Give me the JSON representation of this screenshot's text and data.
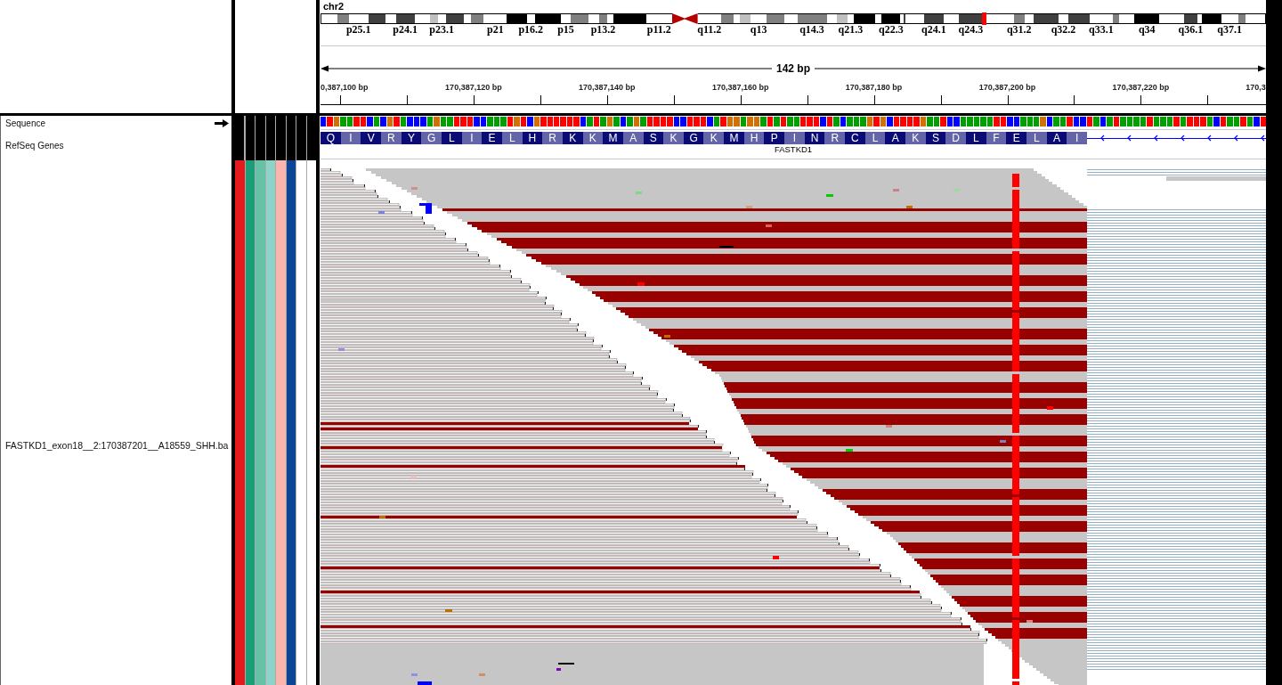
{
  "ideogram": {
    "chromosome": "chr2",
    "bands": [
      {
        "kind": "band",
        "color": "#ffffff"
      },
      {
        "kind": "band",
        "color": "#808080"
      },
      {
        "kind": "band",
        "color": "#ffffff",
        "label": "p25.1"
      },
      {
        "kind": "band",
        "color": "#404040"
      },
      {
        "kind": "band",
        "color": "#ffffff"
      },
      {
        "kind": "band",
        "color": "#404040",
        "label": "p24.1"
      },
      {
        "kind": "band",
        "color": "#ffffff"
      },
      {
        "kind": "band",
        "color": "#c0c0c0"
      },
      {
        "kind": "band",
        "color": "#ffffff",
        "label": "p23.1"
      },
      {
        "kind": "band",
        "color": "#404040"
      },
      {
        "kind": "band",
        "color": "#ffffff"
      },
      {
        "kind": "band",
        "color": "#808080"
      },
      {
        "kind": "band",
        "color": "#ffffff",
        "label": "p21"
      },
      {
        "kind": "band",
        "color": "#000000"
      },
      {
        "kind": "band",
        "color": "#ffffff",
        "label": "p16.2"
      },
      {
        "kind": "band",
        "color": "#000000"
      },
      {
        "kind": "band",
        "color": "#ffffff",
        "label": "p15"
      },
      {
        "kind": "band",
        "color": "#808080"
      },
      {
        "kind": "band",
        "color": "#ffffff"
      },
      {
        "kind": "band",
        "color": "#808080",
        "label": "p13.2"
      },
      {
        "kind": "band",
        "color": "#ffffff"
      },
      {
        "kind": "band",
        "color": "#000000"
      },
      {
        "kind": "band",
        "color": "#ffffff",
        "label": "p11.2"
      },
      {
        "kind": "centromere",
        "color": "#b40000"
      },
      {
        "kind": "centromere",
        "color": "#b40000"
      },
      {
        "kind": "band",
        "color": "#ffffff",
        "label": "q11.2"
      },
      {
        "kind": "band",
        "color": "#808080"
      },
      {
        "kind": "band",
        "color": "#ffffff"
      },
      {
        "kind": "band",
        "color": "#c0c0c0"
      },
      {
        "kind": "band",
        "color": "#ffffff",
        "label": "q13"
      },
      {
        "kind": "band",
        "color": "#808080"
      },
      {
        "kind": "band",
        "color": "#ffffff"
      },
      {
        "kind": "band",
        "color": "#808080",
        "label": "q14.3"
      },
      {
        "kind": "band",
        "color": "#ffffff"
      },
      {
        "kind": "band",
        "color": "#c0c0c0"
      },
      {
        "kind": "band",
        "color": "#ffffff",
        "label": "q21.3"
      },
      {
        "kind": "band",
        "color": "#000000"
      },
      {
        "kind": "band",
        "color": "#ffffff"
      },
      {
        "kind": "band",
        "color": "#000000",
        "label": "q22.3"
      },
      {
        "kind": "band",
        "color": "#ffffff"
      },
      {
        "kind": "band",
        "color": "#404040"
      },
      {
        "kind": "band",
        "color": "#ffffff"
      },
      {
        "kind": "band",
        "color": "#404040",
        "label": "q24.1"
      },
      {
        "kind": "band",
        "color": "#ffffff"
      },
      {
        "kind": "band",
        "color": "#404040",
        "label": "q24.3"
      },
      {
        "kind": "band",
        "color": "#ffffff"
      },
      {
        "kind": "band",
        "color": "#808080",
        "label": "q31.2"
      },
      {
        "kind": "band",
        "color": "#ffffff"
      },
      {
        "kind": "band",
        "color": "#404040"
      },
      {
        "kind": "band",
        "color": "#ffffff",
        "label": "q32.2"
      },
      {
        "kind": "band",
        "color": "#404040"
      },
      {
        "kind": "band",
        "color": "#ffffff",
        "label": "q33.1"
      },
      {
        "kind": "band",
        "color": "#808080"
      },
      {
        "kind": "band",
        "color": "#ffffff"
      },
      {
        "kind": "band",
        "color": "#000000",
        "label": "q34"
      },
      {
        "kind": "band",
        "color": "#ffffff"
      },
      {
        "kind": "band",
        "color": "#404040",
        "label": "q36.1"
      },
      {
        "kind": "band",
        "color": "#ffffff"
      },
      {
        "kind": "band",
        "color": "#000000"
      },
      {
        "kind": "band",
        "color": "#ffffff",
        "label": "q37.1"
      },
      {
        "kind": "band",
        "color": "#808080"
      },
      {
        "kind": "band",
        "color": "#ffffff"
      }
    ]
  },
  "ruler": {
    "span": "142 bp",
    "tick_labels": [
      "0,387,100 bp",
      "170,387,120 bp",
      "170,387,140 bp",
      "170,387,160 bp",
      "170,387,180 bp",
      "170,387,200 bp",
      "170,387,220 bp",
      "170,3"
    ]
  },
  "tracks": [
    {
      "kind": "sequence",
      "name": "Sequence",
      "reverse": false,
      "bases": [
        {
          "color": "#0000ff"
        },
        {
          "color": "#ff0000"
        },
        {
          "color": "#d17105"
        },
        {
          "color": "#00a000"
        },
        {
          "color": "#00a000"
        },
        {
          "color": "#ff0000"
        },
        {
          "color": "#ff0000"
        },
        {
          "color": "#0000ff"
        },
        {
          "color": "#00a000"
        },
        {
          "color": "#0000ff"
        },
        {
          "color": "#d17105"
        },
        {
          "color": "#ff0000"
        },
        {
          "color": "#00a000"
        },
        {
          "color": "#0000ff"
        },
        {
          "color": "#0000ff"
        },
        {
          "color": "#0000ff"
        },
        {
          "color": "#00a000"
        },
        {
          "color": "#d17105"
        },
        {
          "color": "#00a000"
        },
        {
          "color": "#00a000"
        },
        {
          "color": "#ff0000"
        },
        {
          "color": "#ff0000"
        },
        {
          "color": "#ff0000"
        },
        {
          "color": "#0000ff"
        },
        {
          "color": "#0000ff"
        },
        {
          "color": "#00a000"
        },
        {
          "color": "#00a000"
        },
        {
          "color": "#00a000"
        },
        {
          "color": "#ff0000"
        },
        {
          "color": "#d17105"
        },
        {
          "color": "#ff0000"
        },
        {
          "color": "#0000ff"
        },
        {
          "color": "#d17105"
        },
        {
          "color": "#ff0000"
        },
        {
          "color": "#ff0000"
        },
        {
          "color": "#ff0000"
        },
        {
          "color": "#ff0000"
        },
        {
          "color": "#ff0000"
        },
        {
          "color": "#ff0000"
        },
        {
          "color": "#0000ff"
        },
        {
          "color": "#00a000"
        },
        {
          "color": "#ff0000"
        },
        {
          "color": "#00a000"
        },
        {
          "color": "#d17105"
        },
        {
          "color": "#00a000"
        },
        {
          "color": "#0000ff"
        },
        {
          "color": "#00a000"
        },
        {
          "color": "#d17105"
        },
        {
          "color": "#00a000"
        },
        {
          "color": "#ff0000"
        },
        {
          "color": "#ff0000"
        },
        {
          "color": "#ff0000"
        },
        {
          "color": "#ff0000"
        },
        {
          "color": "#0000ff"
        },
        {
          "color": "#0000ff"
        },
        {
          "color": "#ff0000"
        },
        {
          "color": "#ff0000"
        },
        {
          "color": "#ff0000"
        },
        {
          "color": "#0000ff"
        },
        {
          "color": "#00a000"
        },
        {
          "color": "#ff0000"
        },
        {
          "color": "#d17105"
        },
        {
          "color": "#d17105"
        },
        {
          "color": "#00a000"
        },
        {
          "color": "#d17105"
        },
        {
          "color": "#d17105"
        },
        {
          "color": "#00a000"
        },
        {
          "color": "#ff0000"
        },
        {
          "color": "#00a000"
        },
        {
          "color": "#ff0000"
        },
        {
          "color": "#00a000"
        },
        {
          "color": "#00a000"
        },
        {
          "color": "#ff0000"
        },
        {
          "color": "#ff0000"
        },
        {
          "color": "#ff0000"
        },
        {
          "color": "#0000ff"
        },
        {
          "color": "#ff0000"
        },
        {
          "color": "#00a000"
        },
        {
          "color": "#0000ff"
        },
        {
          "color": "#00a000"
        },
        {
          "color": "#00a000"
        },
        {
          "color": "#00a000"
        },
        {
          "color": "#d17105"
        },
        {
          "color": "#ff0000"
        },
        {
          "color": "#d17105"
        },
        {
          "color": "#0000ff"
        },
        {
          "color": "#ff0000"
        },
        {
          "color": "#ff0000"
        },
        {
          "color": "#ff0000"
        },
        {
          "color": "#ff0000"
        },
        {
          "color": "#d17105"
        },
        {
          "color": "#00a000"
        },
        {
          "color": "#00a000"
        },
        {
          "color": "#ff0000"
        },
        {
          "color": "#0000ff"
        },
        {
          "color": "#0000ff"
        },
        {
          "color": "#00a000"
        },
        {
          "color": "#00a000"
        },
        {
          "color": "#00a000"
        },
        {
          "color": "#00a000"
        },
        {
          "color": "#00a000"
        },
        {
          "color": "#ff0000"
        },
        {
          "color": "#ff0000"
        },
        {
          "color": "#0000ff"
        },
        {
          "color": "#0000ff"
        },
        {
          "color": "#00a000"
        },
        {
          "color": "#00a000"
        },
        {
          "color": "#00a000"
        },
        {
          "color": "#d17105"
        },
        {
          "color": "#0000ff"
        },
        {
          "color": "#00a000"
        },
        {
          "color": "#00a000"
        },
        {
          "color": "#ff0000"
        },
        {
          "color": "#0000ff"
        },
        {
          "color": "#0000ff"
        },
        {
          "color": "#ff0000"
        },
        {
          "color": "#00a000"
        },
        {
          "color": "#0000ff"
        },
        {
          "color": "#00a000"
        },
        {
          "color": "#ff0000"
        },
        {
          "color": "#00a000"
        },
        {
          "color": "#00a000"
        },
        {
          "color": "#00a000"
        },
        {
          "color": "#00a000"
        },
        {
          "color": "#ff0000"
        },
        {
          "color": "#00a000"
        },
        {
          "color": "#00a000"
        },
        {
          "color": "#00a000"
        },
        {
          "color": "#ff0000"
        },
        {
          "color": "#00a000"
        },
        {
          "color": "#ff0000"
        },
        {
          "color": "#ff0000"
        },
        {
          "color": "#ff0000"
        },
        {
          "color": "#00a000"
        },
        {
          "color": "#0000ff"
        },
        {
          "color": "#ff0000"
        },
        {
          "color": "#00a000"
        },
        {
          "color": "#00a000"
        },
        {
          "color": "#ff0000"
        },
        {
          "color": "#00a000"
        },
        {
          "color": "#0000ff"
        },
        {
          "color": "#ff0000"
        }
      ]
    },
    {
      "kind": "gene",
      "name": "RefSeq Genes",
      "gene": "FASTKD1",
      "reverse": true,
      "amino_acids": [
        "Q",
        "I",
        "V",
        "R",
        "Y",
        "G",
        "L",
        "I",
        "E",
        "L",
        "H",
        "R",
        "K",
        "K",
        "M",
        "A",
        "S",
        "K",
        "G",
        "K",
        "M",
        "H",
        "P",
        "I",
        "N",
        "R",
        "C",
        "L",
        "A",
        "K",
        "S",
        "D",
        "L",
        "F",
        "E",
        "L",
        "A",
        "I"
      ]
    },
    {
      "kind": "alignment",
      "name": "FASTKD1_exon18__2:170387201__A18559_SHH.ba",
      "attributes": [
        {
          "color": "#e41a1c"
        },
        {
          "color": "#1b9e77"
        },
        {
          "color": "#66c2a5"
        },
        {
          "color": "#8dd3c7"
        },
        {
          "color": "#fbb4ae"
        },
        {
          "color": "#0b4596"
        },
        {
          "color": "#ffffff"
        },
        {
          "color": "#ffffff"
        }
      ]
    }
  ]
}
